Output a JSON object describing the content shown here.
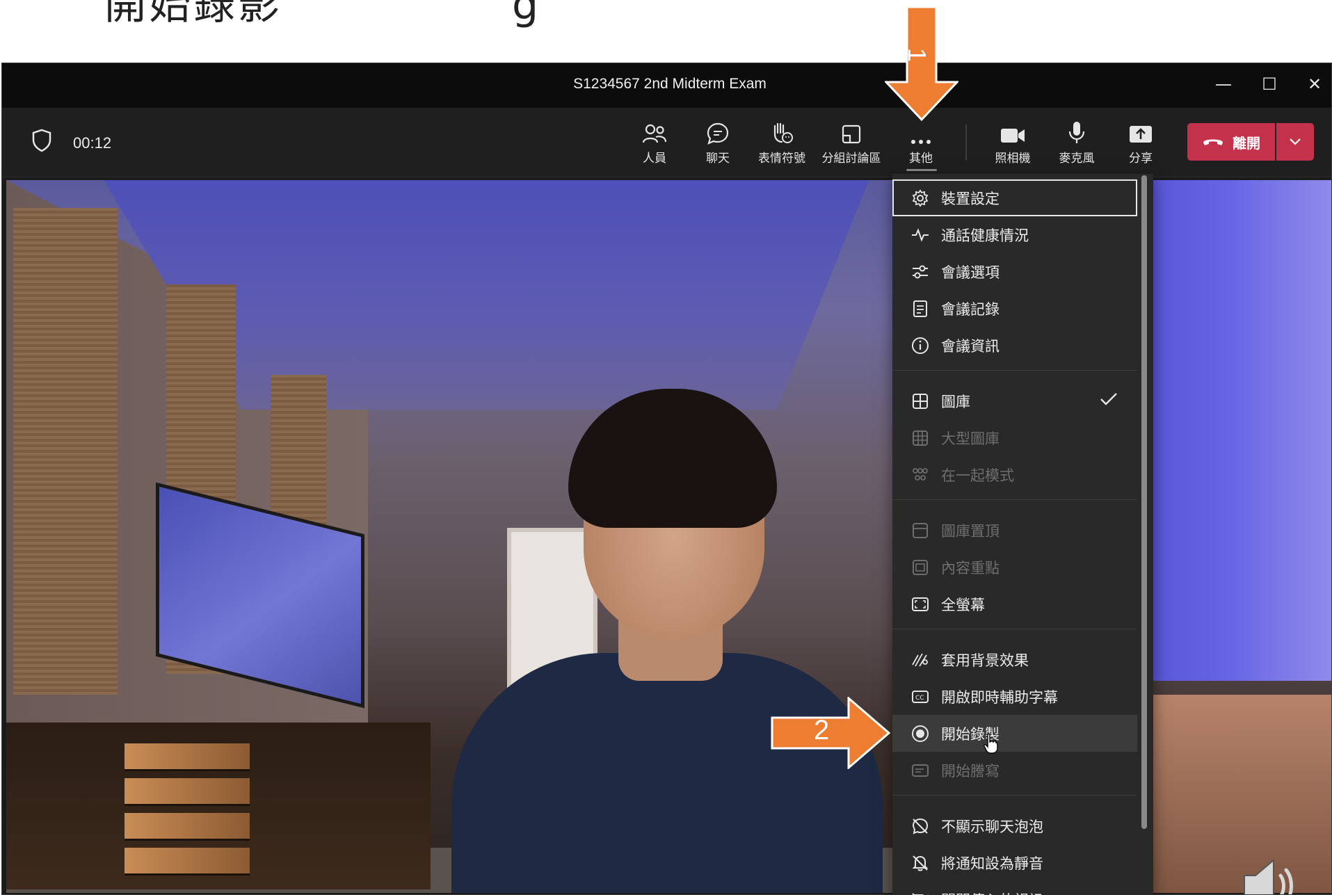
{
  "slide": {
    "title_left": "開始錄影",
    "title_right": "g"
  },
  "window": {
    "title": "S1234567 2nd Midterm Exam",
    "minimize": "—",
    "maximize": "☐",
    "close": "✕"
  },
  "toolbar": {
    "timer": "00:12",
    "buttons": [
      {
        "label": "人員",
        "icon": "people-icon"
      },
      {
        "label": "聊天",
        "icon": "chat-icon"
      },
      {
        "label": "表情符號",
        "icon": "reaction-icon"
      },
      {
        "label": "分組討論區",
        "icon": "breakout-rooms-icon"
      },
      {
        "label": "其他",
        "icon": "more-icon"
      },
      {
        "label": "照相機",
        "icon": "camera-icon"
      },
      {
        "label": "麥克風",
        "icon": "microphone-icon"
      },
      {
        "label": "分享",
        "icon": "share-icon"
      }
    ],
    "leave_label": "離開"
  },
  "menu": {
    "items": [
      {
        "label": "裝置設定",
        "icon": "gear-icon",
        "disabled": false
      },
      {
        "label": "通話健康情況",
        "icon": "pulse-icon",
        "disabled": false
      },
      {
        "label": "會議選項",
        "icon": "sliders-icon",
        "disabled": false
      },
      {
        "label": "會議記錄",
        "icon": "notes-icon",
        "disabled": false
      },
      {
        "label": "會議資訊",
        "icon": "info-icon",
        "disabled": false
      },
      {
        "label": "圖庫",
        "icon": "gallery-icon",
        "disabled": false,
        "checked": true
      },
      {
        "label": "大型圖庫",
        "icon": "large-gallery-icon",
        "disabled": true
      },
      {
        "label": "在一起模式",
        "icon": "together-mode-icon",
        "disabled": true
      },
      {
        "label": "圖庫置頂",
        "icon": "gallery-top-icon",
        "disabled": true
      },
      {
        "label": "內容重點",
        "icon": "focus-content-icon",
        "disabled": true
      },
      {
        "label": "全螢幕",
        "icon": "fullscreen-icon",
        "disabled": false
      },
      {
        "label": "套用背景效果",
        "icon": "background-effects-icon",
        "disabled": false
      },
      {
        "label": "開啟即時輔助字幕",
        "icon": "captions-icon",
        "disabled": false
      },
      {
        "label": "開始錄製",
        "icon": "record-icon",
        "disabled": false
      },
      {
        "label": "開始謄寫",
        "icon": "transcript-icon",
        "disabled": true
      },
      {
        "label": "不顯示聊天泡泡",
        "icon": "chat-bubble-off-icon",
        "disabled": false
      },
      {
        "label": "將通知設為靜音",
        "icon": "bell-off-icon",
        "disabled": false
      },
      {
        "label": "關閉傳入的視訊",
        "icon": "video-off-icon",
        "disabled": false
      }
    ]
  },
  "annotations": {
    "step1": "1",
    "step2": "2"
  },
  "colors": {
    "leave_red": "#c4314b",
    "annotation_orange": "#ed7d31"
  }
}
